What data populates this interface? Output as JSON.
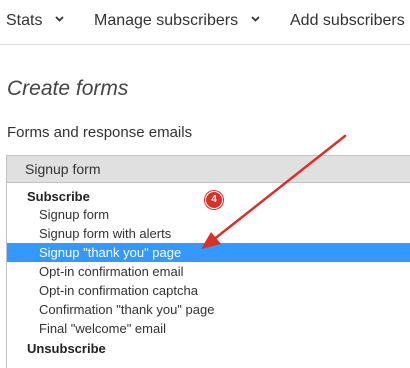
{
  "nav": {
    "items": [
      {
        "label": "Stats"
      },
      {
        "label": "Manage subscribers"
      },
      {
        "label": "Add subscribers"
      }
    ]
  },
  "page": {
    "title": "Create forms",
    "section_title": "Forms and response emails"
  },
  "select": {
    "selected_value": "Signup form",
    "groups": [
      {
        "label": "Subscribe",
        "options": [
          "Signup form",
          "Signup form with alerts",
          "Signup \"thank you\" page",
          "Opt-in confirmation email",
          "Opt-in confirmation captcha",
          "Confirmation \"thank you\" page",
          "Final \"welcome\" email"
        ]
      },
      {
        "label": "Unsubscribe",
        "options": []
      }
    ],
    "highlighted_option": "Signup \"thank you\" page"
  },
  "annotation": {
    "step_number": "4",
    "color": "#d9302a"
  },
  "colors": {
    "selection": "#3399ff",
    "header_bg": "#e0e0e0"
  }
}
